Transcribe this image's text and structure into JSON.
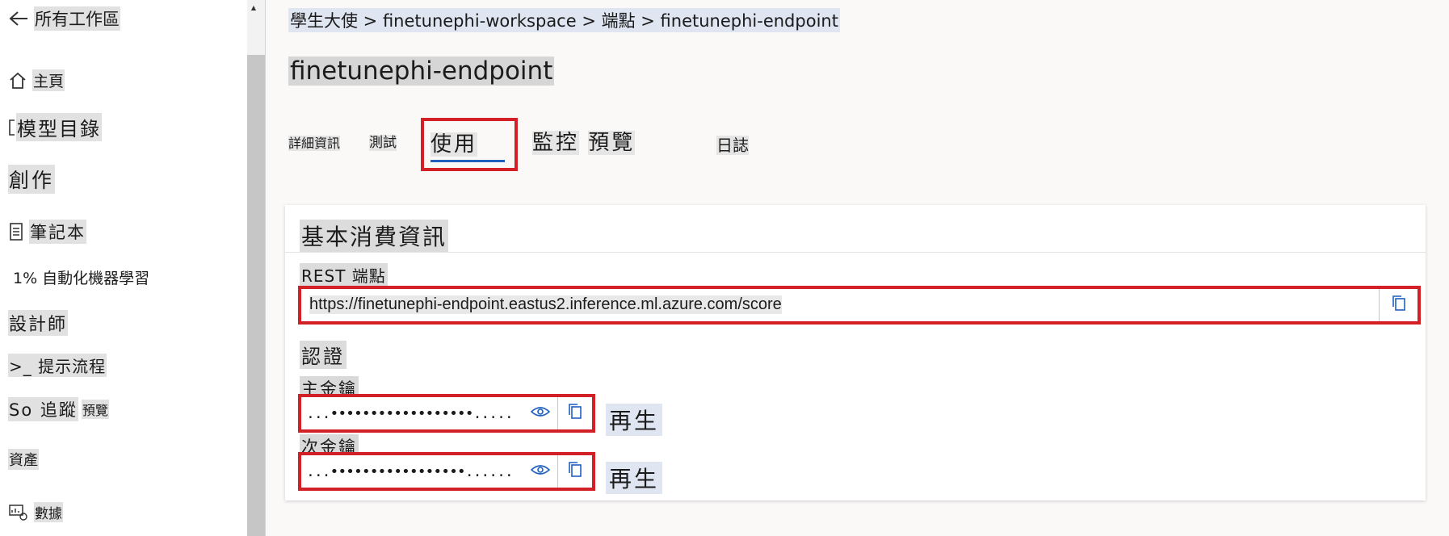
{
  "nav": {
    "back_label": "所有工作區",
    "items": [
      {
        "label": "主頁",
        "icon": "home-icon"
      },
      {
        "label": "模型目錄",
        "icon": "catalog-icon"
      },
      {
        "label": "創作",
        "icon": ""
      },
      {
        "label": "筆記本",
        "icon": "notebook-icon"
      },
      {
        "label": "1% 自動化機器學習",
        "icon": ""
      },
      {
        "label": "設計師",
        "icon": ""
      },
      {
        "label": ">_ 提示流程",
        "icon": ""
      },
      {
        "label": "So 追蹤",
        "icon": "",
        "badge": "預覽"
      },
      {
        "label": "資產",
        "icon": ""
      },
      {
        "label": "數據",
        "icon": "data-icon"
      }
    ]
  },
  "breadcrumb": "學生大使 > finetunephi-workspace > 端點 > finetunephi-endpoint",
  "page_title": "finetunephi-endpoint",
  "tabs": {
    "details": "詳細資訊",
    "test": "測試",
    "consume": "使用",
    "monitor": "監控",
    "monitor_badge": "預覽",
    "logs": "日誌"
  },
  "card": {
    "title": "基本消費資訊",
    "rest_label": "REST 端點",
    "rest_url": "https://finetunephi-endpoint.eastus2.inference.ml.azure.com/score",
    "auth_label": "認證",
    "primary_key_label": "主金鑰",
    "primary_key_value": "...••••••••••••••••••.....",
    "secondary_key_label": "次金鑰",
    "secondary_key_value": "...•••••••••••••••••......",
    "regenerate_label": "再生"
  },
  "colors": {
    "highlight_box": "#d32026",
    "accent": "#1f5fbf"
  }
}
